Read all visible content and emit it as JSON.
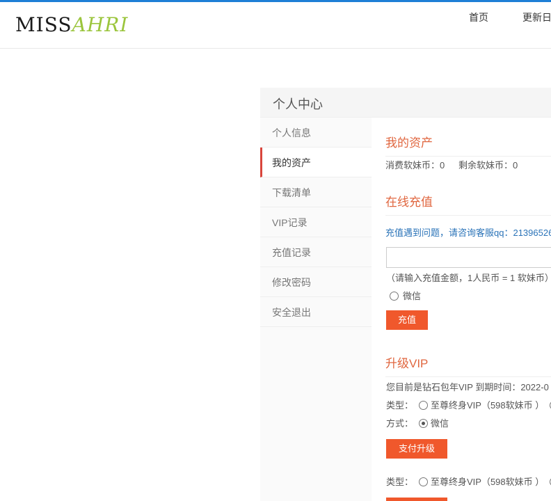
{
  "brand": {
    "part1": "MISS",
    "part2": "AHRI"
  },
  "nav": {
    "home": "首页",
    "update": "更新日"
  },
  "panel": {
    "title": "个人中心"
  },
  "sidebar": {
    "items": [
      {
        "label": "个人信息"
      },
      {
        "label": "我的资产"
      },
      {
        "label": "下载清单"
      },
      {
        "label": "VIP记录"
      },
      {
        "label": "充值记录"
      },
      {
        "label": "修改密码"
      },
      {
        "label": "安全退出"
      }
    ]
  },
  "assets": {
    "title": "我的资产",
    "consumed": "消费软妹币：0",
    "remaining": "剩余软妹币：0"
  },
  "recharge": {
    "title": "在线充值",
    "help": "充值遇到问题，请咨询客服qq：21396526",
    "amount_value": "",
    "hint": "（请输入充值金额，1人民币 = 1 软妹币）",
    "pay_method": "微信",
    "button": "充值"
  },
  "vip": {
    "title": "升级VIP",
    "status": "您目前是钻石包年VIP   到期时间：2022-0",
    "type_label": "类型：",
    "type_option": "至尊终身VIP（598软妹币 ）",
    "method_label": "方式：",
    "method_option": "微信",
    "button": "支付升级",
    "type_label_2": "类型：",
    "type_option_2": "至尊终身VIP（598软妹币 ）"
  },
  "colors": {
    "accent": "#f0582c",
    "title": "#e0663f",
    "active_bar": "#d9453c",
    "topline": "#1e7fd6",
    "link": "#2a73b8",
    "logo_green": "#9bc53d"
  }
}
